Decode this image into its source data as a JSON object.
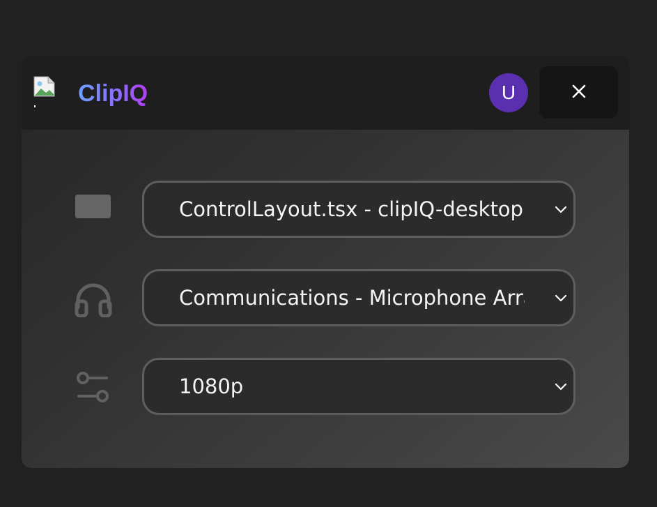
{
  "app": {
    "brand": "ClipIQ",
    "avatar_initial": "U",
    "colors": {
      "brand_gradient_start": "#6ba0ff",
      "brand_gradient_end": "#b43cf5",
      "avatar_bg": "#5a30b0"
    }
  },
  "header": {
    "logo_icon": "broken-image-icon",
    "close_icon": "close-icon"
  },
  "settings": {
    "source": {
      "icon": "screen-icon",
      "value": "ControlLayout.tsx - clipIQ-desktop - Visual Studio Code"
    },
    "microphone": {
      "icon": "headphones-icon",
      "value": "Communications - Microphone Array"
    },
    "quality": {
      "icon": "sliders-icon",
      "value": "1080p"
    }
  }
}
